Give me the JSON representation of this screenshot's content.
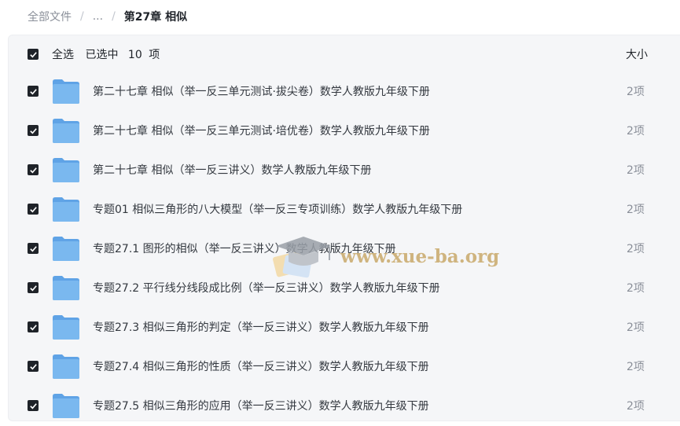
{
  "breadcrumb": {
    "root": "全部文件",
    "ellipsis": "...",
    "separator": "/",
    "current": "第27章 相似"
  },
  "list_header": {
    "select_all_label": "全选",
    "selected_prefix": "已选中",
    "selected_count": "10",
    "selected_suffix": "项",
    "size_column_label": "大小",
    "select_all_checked": true
  },
  "files": [
    {
      "name": "第二十七章 相似（举一反三单元测试·拔尖卷）数学人教版九年级下册",
      "size": "2项",
      "checked": true,
      "icon": "folder-icon"
    },
    {
      "name": "第二十七章 相似（举一反三单元测试·培优卷）数学人教版九年级下册",
      "size": "2项",
      "checked": true,
      "icon": "folder-icon"
    },
    {
      "name": "第二十七章 相似（举一反三讲义）数学人教版九年级下册",
      "size": "2项",
      "checked": true,
      "icon": "folder-icon"
    },
    {
      "name": "专题01 相似三角形的八大模型（举一反三专项训练）数学人教版九年级下册",
      "size": "2项",
      "checked": true,
      "icon": "folder-icon"
    },
    {
      "name": "专题27.1 图形的相似（举一反三讲义）数学人教版九年级下册",
      "size": "2项",
      "checked": true,
      "icon": "folder-icon"
    },
    {
      "name": "专题27.2 平行线分线段成比例（举一反三讲义）数学人教版九年级下册",
      "size": "2项",
      "checked": true,
      "icon": "folder-icon"
    },
    {
      "name": "专题27.3 相似三角形的判定（举一反三讲义）数学人教版九年级下册",
      "size": "2项",
      "checked": true,
      "icon": "folder-icon"
    },
    {
      "name": "专题27.4 相似三角形的性质（举一反三讲义）数学人教版九年级下册",
      "size": "2项",
      "checked": true,
      "icon": "folder-icon"
    },
    {
      "name": "专题27.5 相似三角形的应用（举一反三讲义）数学人教版九年级下册",
      "size": "2项",
      "checked": true,
      "icon": "folder-icon"
    }
  ],
  "watermark": {
    "text": "www.xue-ba.org"
  },
  "colors": {
    "checkbox": "#1f2329",
    "folder": "#7ab8ef",
    "folder_tab": "#5fa3e6",
    "panel_bg": "#f5f6f8"
  }
}
